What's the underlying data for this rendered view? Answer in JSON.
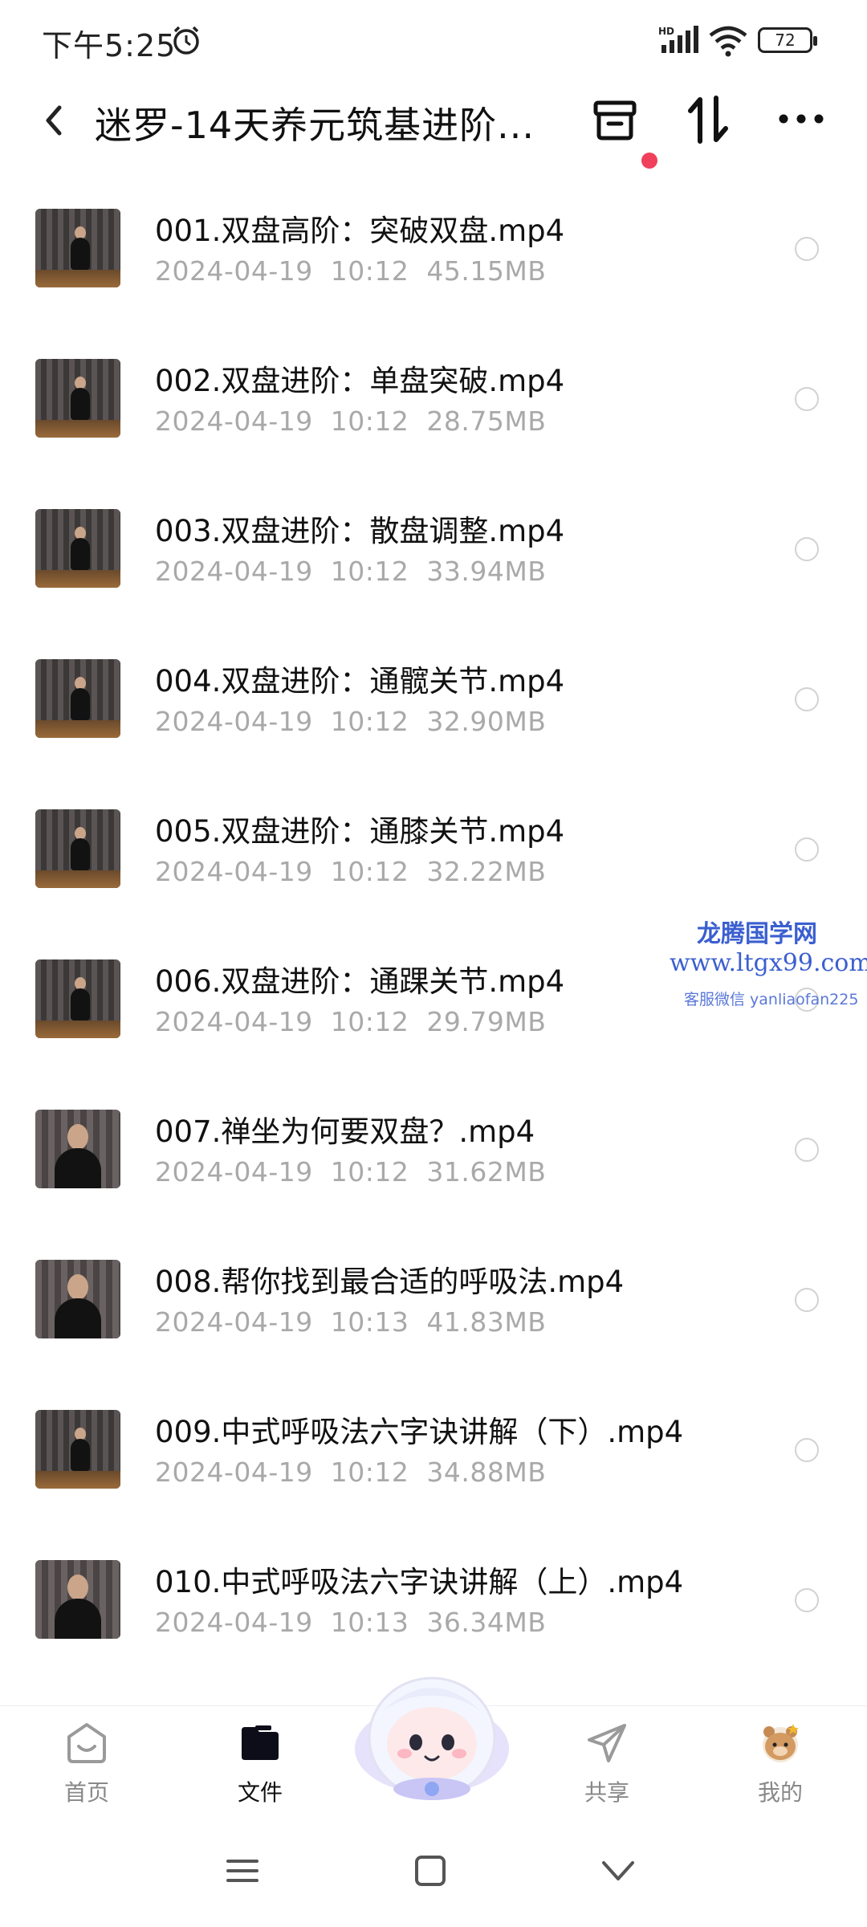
{
  "status": {
    "time": "下午5:25",
    "network": "HD",
    "battery": "72"
  },
  "header": {
    "title": "迷罗-14天养元筑基进阶..."
  },
  "files": [
    {
      "name": "001.双盘高阶：突破双盘.mp4",
      "date": "2024-04-19",
      "time": "10:12",
      "size": "45.15MB"
    },
    {
      "name": "002.双盘进阶：单盘突破.mp4",
      "date": "2024-04-19",
      "time": "10:12",
      "size": "28.75MB"
    },
    {
      "name": "003.双盘进阶：散盘调整.mp4",
      "date": "2024-04-19",
      "time": "10:12",
      "size": "33.94MB"
    },
    {
      "name": "004.双盘进阶：通髋关节.mp4",
      "date": "2024-04-19",
      "time": "10:12",
      "size": "32.90MB"
    },
    {
      "name": "005.双盘进阶：通膝关节.mp4",
      "date": "2024-04-19",
      "time": "10:12",
      "size": "32.22MB"
    },
    {
      "name": "006.双盘进阶：通踝关节.mp4",
      "date": "2024-04-19",
      "time": "10:12",
      "size": "29.79MB"
    },
    {
      "name": "007.禅坐为何要双盘？.mp4",
      "date": "2024-04-19",
      "time": "10:12",
      "size": "31.62MB"
    },
    {
      "name": "008.帮你找到最合适的呼吸法.mp4",
      "date": "2024-04-19",
      "time": "10:13",
      "size": "41.83MB"
    },
    {
      "name": "009.中式呼吸法六字诀讲解（下）.mp4",
      "date": "2024-04-19",
      "time": "10:12",
      "size": "34.88MB"
    },
    {
      "name": "010.中式呼吸法六字诀讲解（上）.mp4",
      "date": "2024-04-19",
      "time": "10:13",
      "size": "36.34MB"
    }
  ],
  "watermark": {
    "line1": "龙腾国学网",
    "line2": "www.ltgx99.com",
    "line3": "客服微信 yanliaofan225"
  },
  "nav": [
    {
      "label": "首页",
      "icon": "home-icon"
    },
    {
      "label": "文件",
      "icon": "folder-icon"
    },
    {
      "label": "共享",
      "icon": "send-icon"
    },
    {
      "label": "我的",
      "icon": "avatar-icon"
    }
  ],
  "colors": {
    "accent_dot": "#f0405c",
    "meta_text": "#a9a9a9",
    "watermark": "#3b5fd0"
  }
}
